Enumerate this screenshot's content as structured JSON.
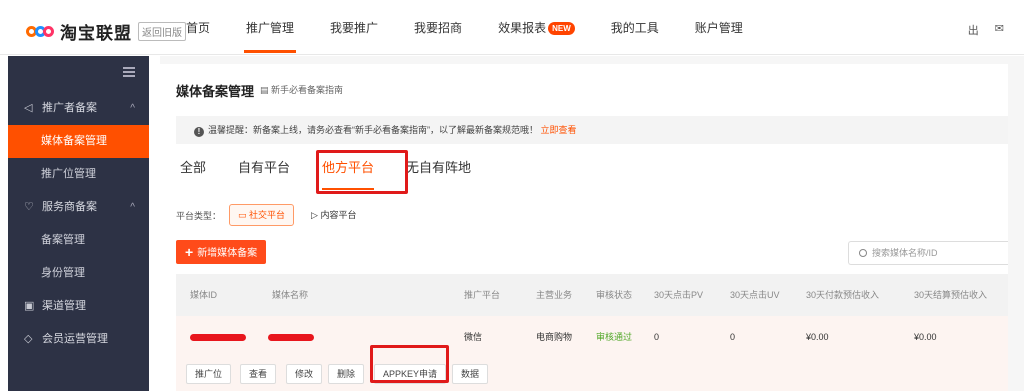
{
  "header": {
    "logo_text": "淘宝联盟",
    "old_version": "返回旧版",
    "nav": [
      {
        "label": "首页"
      },
      {
        "label": "推广管理"
      },
      {
        "label": "我要推广"
      },
      {
        "label": "我要招商"
      },
      {
        "label": "效果报表"
      },
      {
        "label": "我的工具"
      },
      {
        "label": "账户管理"
      }
    ],
    "new_badge": "NEW",
    "right_items": [
      "出",
      "✉"
    ]
  },
  "sidebar": {
    "groups": [
      {
        "label": "推广者备案",
        "icon": "megaphone-icon",
        "caret": "^"
      },
      {
        "label": "服务商备案",
        "icon": "heart-icon",
        "caret": "^"
      },
      {
        "label": "渠道管理",
        "icon": "grid-icon"
      },
      {
        "label": "会员运营管理",
        "icon": "diamond-icon"
      }
    ],
    "items": [
      {
        "label": "媒体备案管理"
      },
      {
        "label": "推广位管理"
      },
      {
        "label": "备案管理"
      },
      {
        "label": "身份管理"
      }
    ]
  },
  "main": {
    "title": "媒体备案管理",
    "guide": "新手必看备案指南",
    "tip_text": "温馨提醒：新备案上线，请务必查看“新手必看备案指南”，以了解最新备案规范哦！",
    "tip_link": "立即查看",
    "tabs": [
      {
        "label": "全部"
      },
      {
        "label": "自有平台"
      },
      {
        "label": "他方平台"
      },
      {
        "label": "无自有阵地"
      }
    ],
    "platform_type_label": "平台类型：",
    "platform_types": [
      {
        "label": "社交平台"
      },
      {
        "label": "内容平台"
      }
    ],
    "add_button": "新增媒体备案",
    "search_placeholder": "搜索媒体名称/ID",
    "table": {
      "columns": [
        "媒体ID",
        "媒体名称",
        "推广平台",
        "主营业务",
        "审核状态",
        "30天点击PV",
        "30天点击UV",
        "30天付款预估收入",
        "30天结算预估收入"
      ],
      "rows": [
        {
          "platform": "微信",
          "business": "电商购物",
          "status": "审核通过",
          "pv": "0",
          "uv": "0",
          "pay_income": "¥0.00",
          "settle_income": "¥0.00"
        }
      ]
    },
    "actions": [
      "推广位",
      "查看",
      "修改",
      "删除",
      "APPKEY申请",
      "数据"
    ]
  }
}
